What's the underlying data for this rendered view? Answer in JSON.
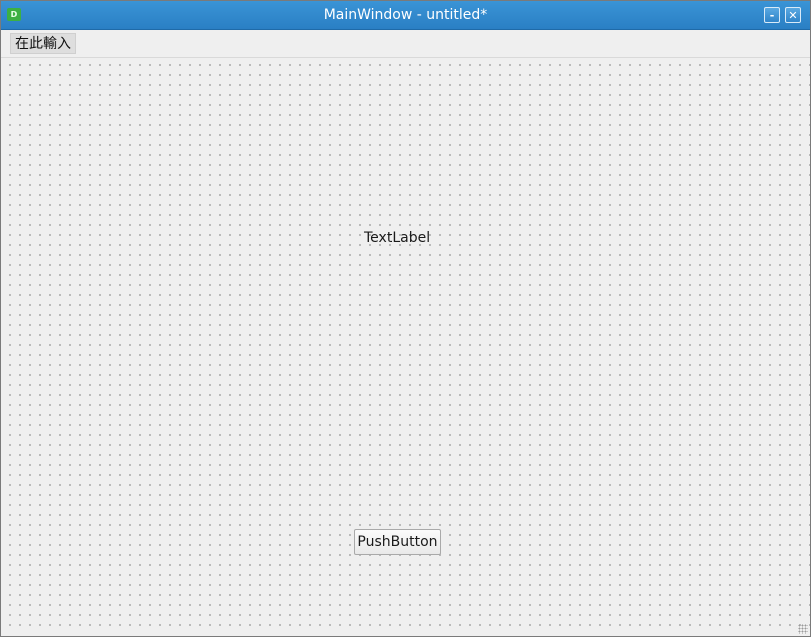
{
  "window": {
    "title": "MainWindow - untitled*",
    "app_icon_glyph": "D",
    "minimize_glyph": "-",
    "close_glyph": "✕"
  },
  "menubar": {
    "placeholder_item": "在此輸入"
  },
  "form": {
    "label_text": "TextLabel",
    "button_text": "PushButton"
  },
  "colors": {
    "titlebar": "#2a7fc4",
    "background": "#efefef",
    "grid_dot": "#a8a8a8"
  }
}
